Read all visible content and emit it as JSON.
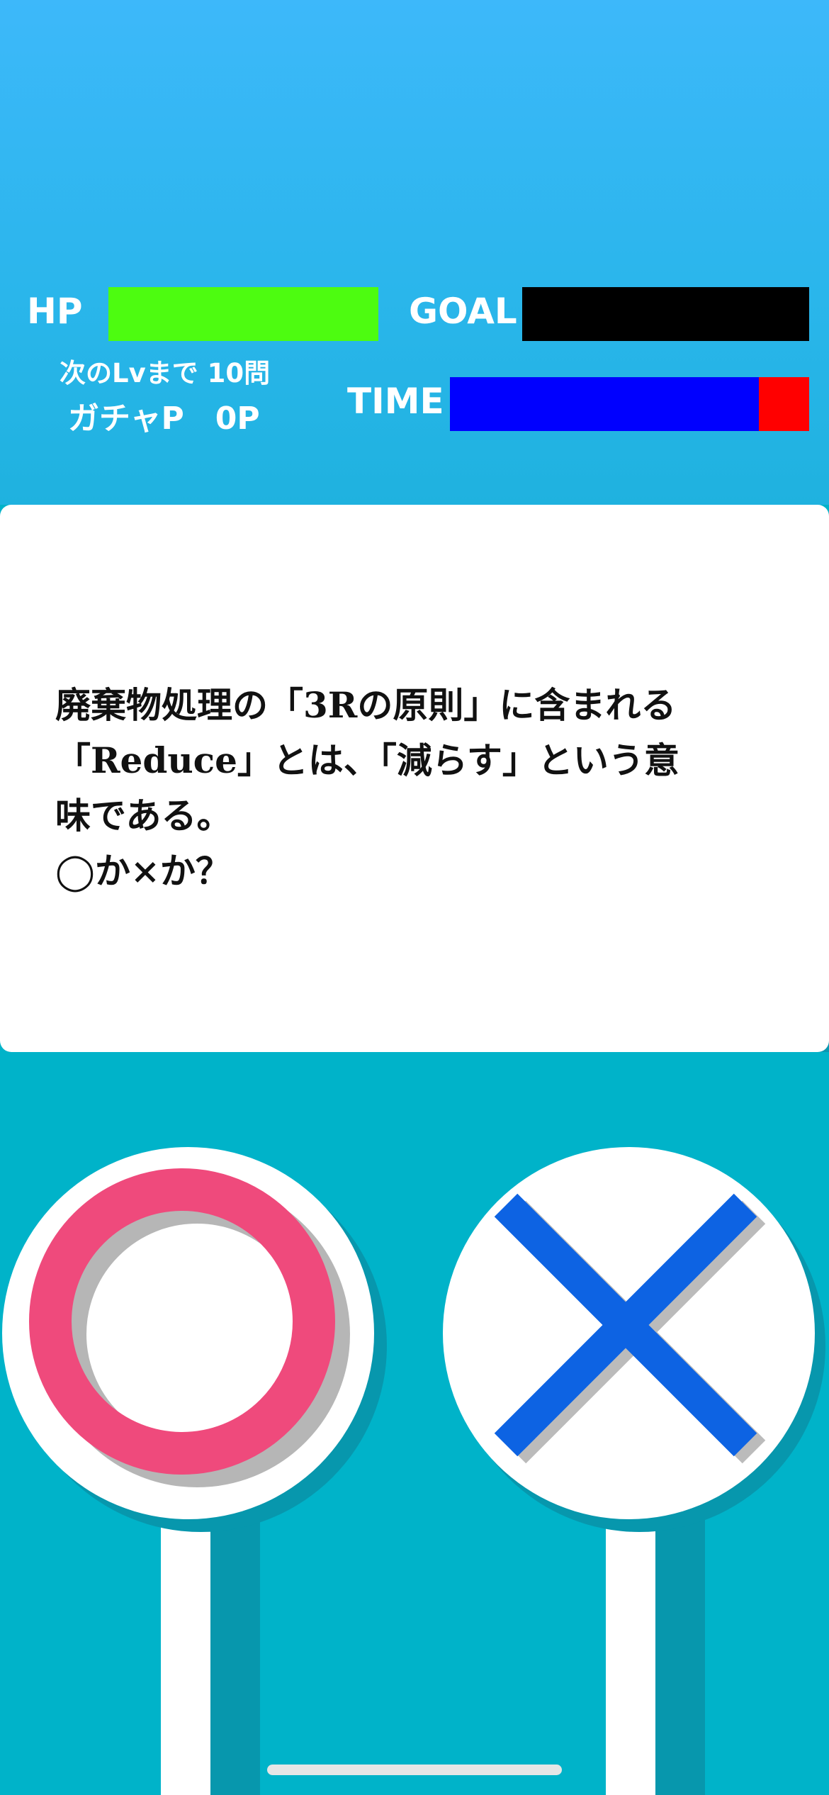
{
  "status": {
    "hp_label": "HP",
    "hp_level": 1.0,
    "goal_label": "GOAL",
    "goal_progress": 0.0,
    "time_label": "TIME",
    "time_remaining": 0.86,
    "next_level_text": "次のLvまで 10問",
    "gacha_points_text": "ガチャP　0P"
  },
  "question": {
    "text": "廃棄物処理の「3Rの原則」に含まれる\n「Reduce」とは、「減らす」という意\n味である。\n◯か×か？"
  },
  "answers": {
    "true_button_icon": "circle-icon",
    "false_button_icon": "cross-icon"
  },
  "colors": {
    "background_top": "#3db8fa",
    "background_bottom": "#00b3c9",
    "hp_bar": "#4dfc10",
    "goal_bar_empty": "#000000",
    "time_bar_remaining": "#0000ff",
    "time_bar_elapsed": "#ff0000",
    "circle_mark": "#ef4a7c",
    "cross_mark": "#0d63e3"
  }
}
